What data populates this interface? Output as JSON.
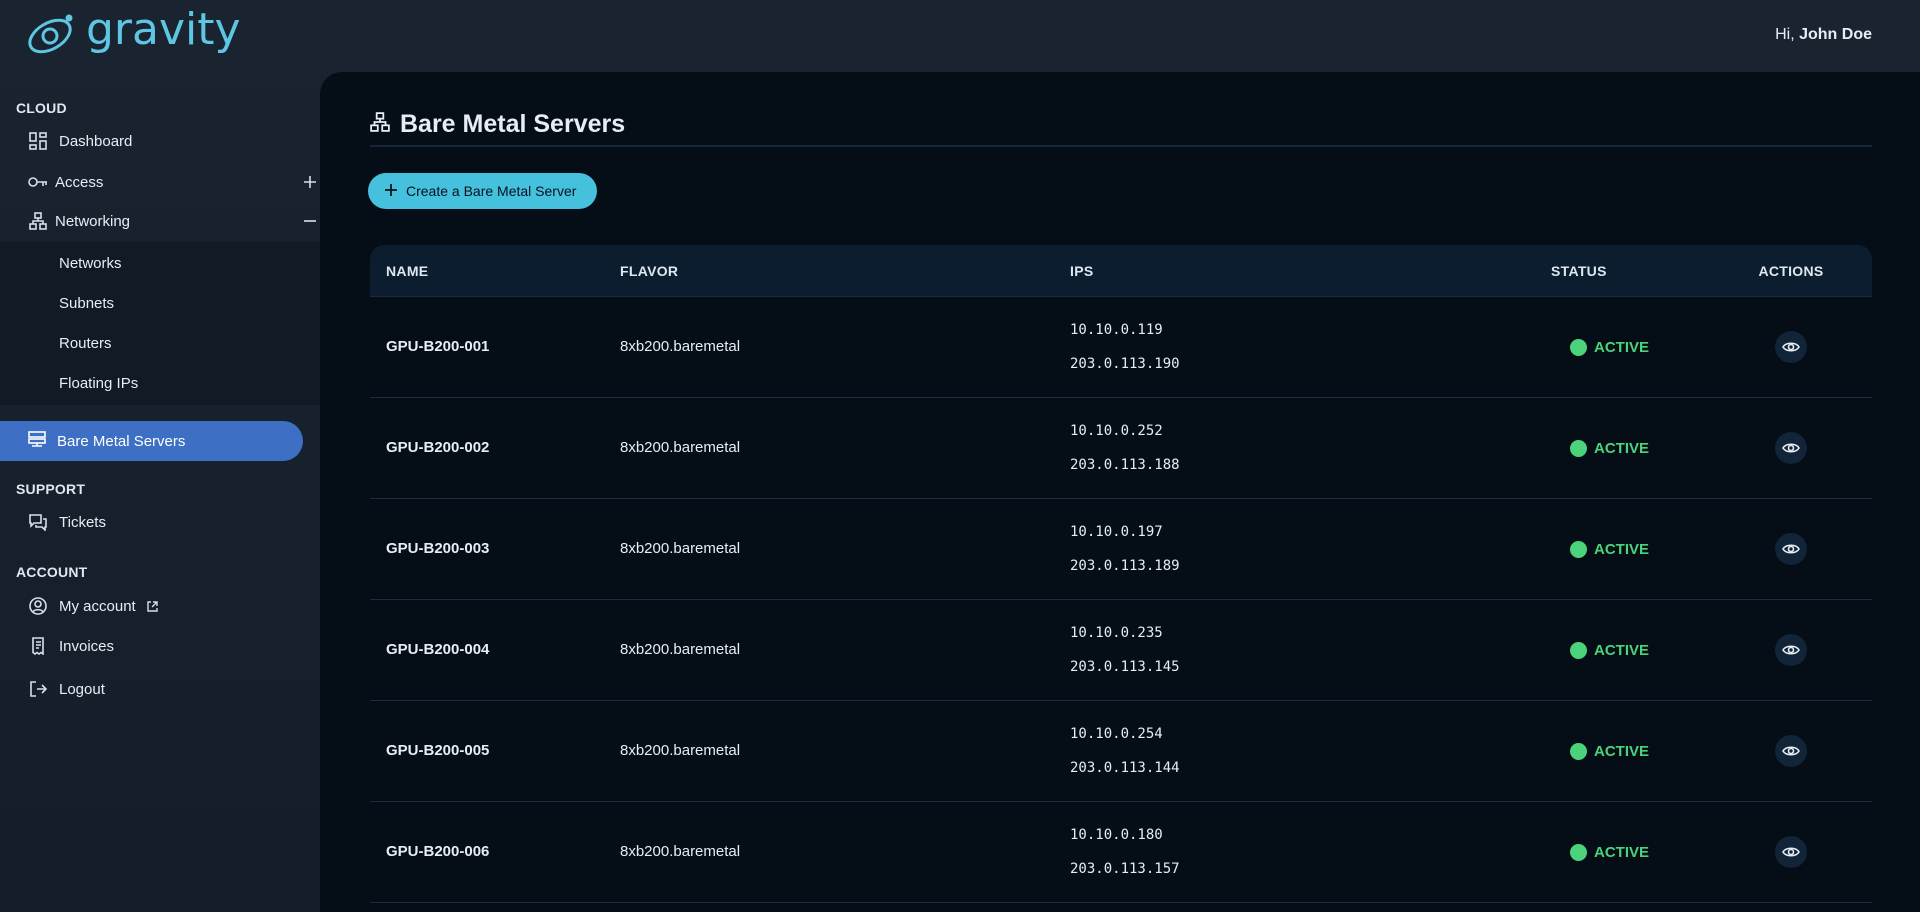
{
  "app": {
    "brand": "gravity",
    "greeting_prefix": "Hi,",
    "user_name": "John Doe"
  },
  "sidebar": {
    "cloud_title": "CLOUD",
    "dashboard": "Dashboard",
    "access": "Access",
    "networking": "Networking",
    "networking_sub": [
      "Networks",
      "Subnets",
      "Routers",
      "Floating IPs"
    ],
    "bare_metal": "Bare Metal Servers",
    "support_title": "SUPPORT",
    "tickets": "Tickets",
    "account_title": "ACCOUNT",
    "my_account": "My account",
    "invoices": "Invoices",
    "logout": "Logout"
  },
  "page": {
    "title": "Bare Metal Servers",
    "create_button": "Create a Bare Metal Server"
  },
  "table": {
    "headers": {
      "name": "NAME",
      "flavor": "FLAVOR",
      "ips": "IPS",
      "status": "STATUS",
      "actions": "ACTIONS"
    },
    "rows": [
      {
        "name": "GPU-B200-001",
        "flavor": "8xb200.baremetal",
        "ip1": "10.10.0.119",
        "ip2": "203.0.113.190",
        "status": "ACTIVE"
      },
      {
        "name": "GPU-B200-002",
        "flavor": "8xb200.baremetal",
        "ip1": "10.10.0.252",
        "ip2": "203.0.113.188",
        "status": "ACTIVE"
      },
      {
        "name": "GPU-B200-003",
        "flavor": "8xb200.baremetal",
        "ip1": "10.10.0.197",
        "ip2": "203.0.113.189",
        "status": "ACTIVE"
      },
      {
        "name": "GPU-B200-004",
        "flavor": "8xb200.baremetal",
        "ip1": "10.10.0.235",
        "ip2": "203.0.113.145",
        "status": "ACTIVE"
      },
      {
        "name": "GPU-B200-005",
        "flavor": "8xb200.baremetal",
        "ip1": "10.10.0.254",
        "ip2": "203.0.113.144",
        "status": "ACTIVE"
      },
      {
        "name": "GPU-B200-006",
        "flavor": "8xb200.baremetal",
        "ip1": "10.10.0.180",
        "ip2": "203.0.113.157",
        "status": "ACTIVE"
      }
    ]
  },
  "colors": {
    "accent": "#45c0dd",
    "active_nav": "#3d6fc4",
    "status_active": "#4bd37b",
    "main_bg": "#050d17"
  }
}
